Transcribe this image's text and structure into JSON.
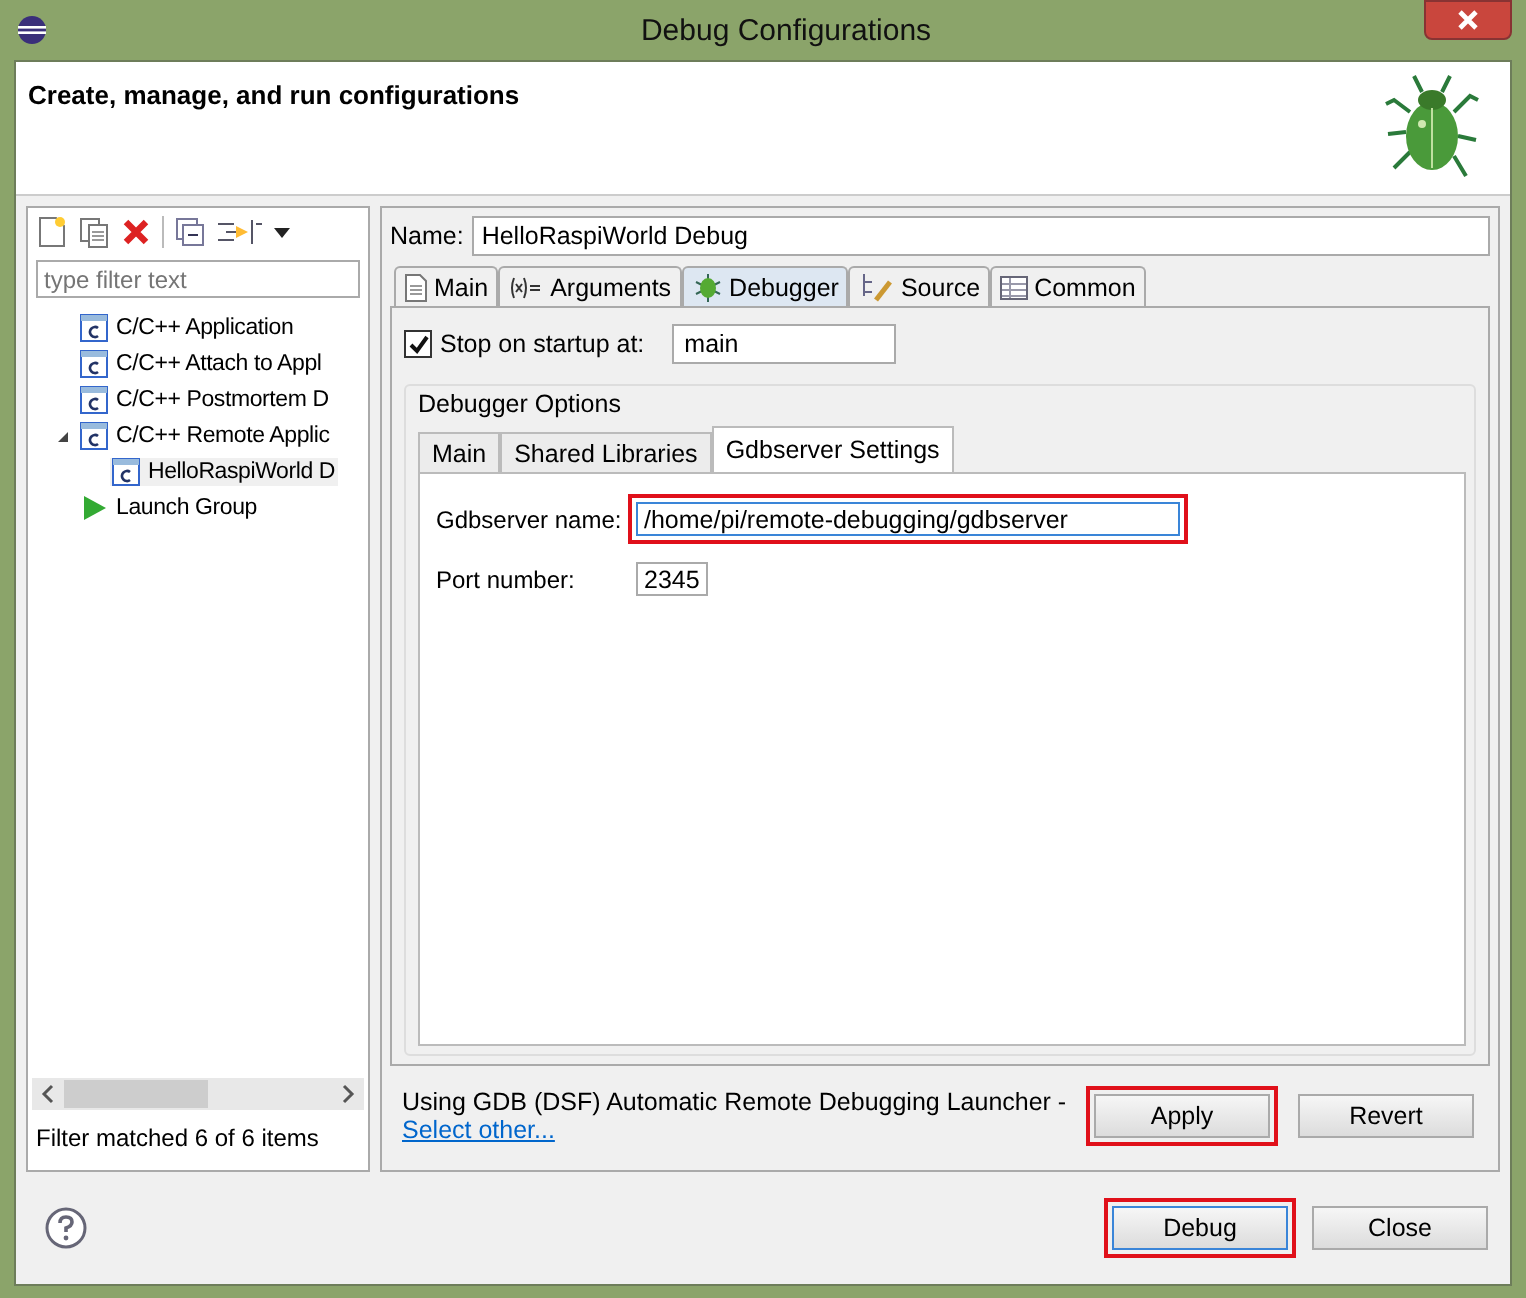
{
  "window": {
    "title": "Debug Configurations"
  },
  "header": {
    "title": "Create, manage, and run configurations"
  },
  "sidebar": {
    "filter": {
      "placeholder": "type filter text"
    },
    "tree": [
      {
        "label": "C/C++ Application",
        "kind": "c",
        "selected": false
      },
      {
        "label": "C/C++ Attach to Appl",
        "kind": "c",
        "selected": false
      },
      {
        "label": "C/C++ Postmortem D",
        "kind": "c",
        "selected": false
      },
      {
        "label": "C/C++ Remote Applic",
        "kind": "c",
        "expanded": true,
        "selected": false,
        "children": [
          {
            "label": "HelloRaspiWorld D",
            "kind": "c",
            "selected": true
          }
        ]
      },
      {
        "label": "Launch Group",
        "kind": "launch",
        "selected": false
      }
    ],
    "status": "Filter matched 6 of 6 items"
  },
  "name": {
    "label": "Name:",
    "value": "HelloRaspiWorld Debug"
  },
  "tabs": [
    {
      "label": "Main",
      "kind": "doc",
      "selected": false
    },
    {
      "label": "Arguments",
      "kind": "args",
      "selected": false
    },
    {
      "label": "Debugger",
      "kind": "bug",
      "selected": true
    },
    {
      "label": "Source",
      "kind": "source",
      "selected": false
    },
    {
      "label": "Common",
      "kind": "table",
      "selected": false
    }
  ],
  "stop_on_startup": {
    "label": "Stop on startup at:",
    "checked": true,
    "value": "main"
  },
  "debugger_options": {
    "title": "Debugger Options",
    "tabs": [
      {
        "label": "Main",
        "selected": false
      },
      {
        "label": "Shared Libraries",
        "selected": false
      },
      {
        "label": "Gdbserver Settings",
        "selected": true
      }
    ],
    "fields": [
      {
        "label": "Gdbserver name:",
        "value": "/home/pi/remote-debugging/gdbserver",
        "highlighted": true
      },
      {
        "label": "Port number:",
        "value": "2345",
        "highlighted": false
      }
    ]
  },
  "launcher": {
    "text": "Using GDB (DSF) Automatic Remote Debugging Launcher -",
    "link": "Select other..."
  },
  "panel_buttons": [
    {
      "label": "Apply",
      "highlighted": true
    },
    {
      "label": "Revert",
      "highlighted": false
    }
  ],
  "dialog_buttons": [
    {
      "label": "Debug",
      "highlighted": true
    },
    {
      "label": "Close",
      "highlighted": false
    }
  ]
}
